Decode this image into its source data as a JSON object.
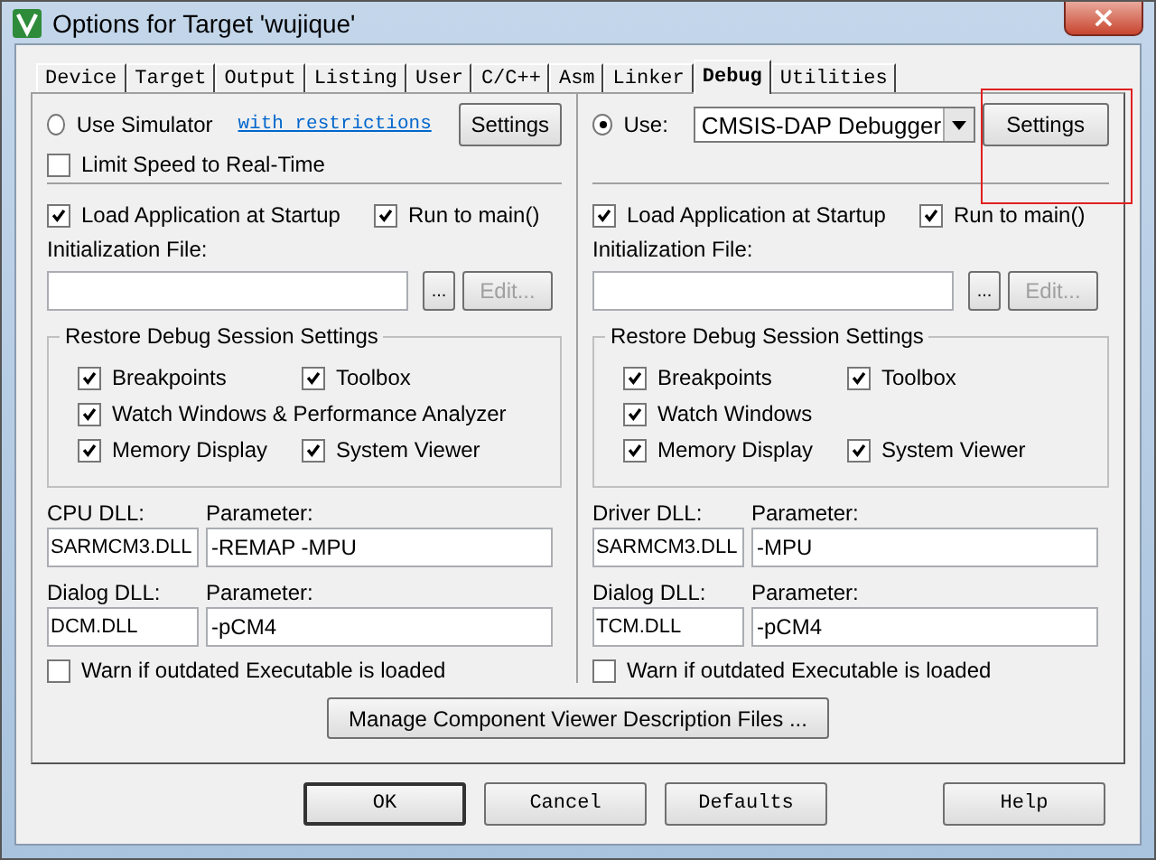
{
  "window": {
    "title": "Options for Target 'wujique'",
    "close": "×"
  },
  "tabs": [
    {
      "label": "Device",
      "selected": false
    },
    {
      "label": "Target",
      "selected": false
    },
    {
      "label": "Output",
      "selected": false
    },
    {
      "label": "Listing",
      "selected": false
    },
    {
      "label": "User",
      "selected": false
    },
    {
      "label": "C/C++",
      "selected": false
    },
    {
      "label": "Asm",
      "selected": false
    },
    {
      "label": "Linker",
      "selected": false
    },
    {
      "label": "Debug",
      "selected": true
    },
    {
      "label": "Utilities",
      "selected": false
    }
  ],
  "simulator": {
    "mode": {
      "label": "Use Simulator",
      "selected": false
    },
    "link": "with restrictions",
    "settings": "Settings",
    "limit_speed": {
      "label": "Limit Speed to Real-Time",
      "checked": false
    }
  },
  "target": {
    "mode": {
      "label": "Use:",
      "selected": true
    },
    "debugger": "CMSIS-DAP Debugger",
    "settings": "Settings"
  },
  "panels": [
    {
      "load_app": {
        "label": "Load Application at Startup",
        "checked": true
      },
      "run_to_main": {
        "label": "Run to main()",
        "checked": true
      },
      "init_label": "Initialization File:",
      "browse": "...",
      "edit": {
        "label": "Edit...",
        "disabled": true
      },
      "restore": {
        "title": "Restore Debug Session Settings",
        "rows": [
          [
            {
              "label": "Breakpoints",
              "checked": true
            },
            {
              "label": "Toolbox",
              "checked": true
            }
          ],
          [
            {
              "label": "Watch Windows & Performance Analyzer",
              "checked": true
            }
          ],
          [
            {
              "label": "Memory Display",
              "checked": true
            },
            {
              "label": "System Viewer",
              "checked": true
            }
          ]
        ]
      },
      "dlls": [
        {
          "label": "CPU DLL:",
          "value": "SARMCM3.DLL",
          "param_label": "Parameter:",
          "param": "-REMAP -MPU"
        },
        {
          "label": "Dialog DLL:",
          "value": "DCM.DLL",
          "param_label": "Parameter:",
          "param": "-pCM4"
        }
      ],
      "warn": {
        "label": "Warn if outdated Executable is loaded",
        "checked": false
      }
    },
    {
      "load_app": {
        "label": "Load Application at Startup",
        "checked": true
      },
      "run_to_main": {
        "label": "Run to main()",
        "checked": true
      },
      "init_label": "Initialization File:",
      "browse": "...",
      "edit": {
        "label": "Edit...",
        "disabled": true
      },
      "restore": {
        "title": "Restore Debug Session Settings",
        "rows": [
          [
            {
              "label": "Breakpoints",
              "checked": true
            },
            {
              "label": "Toolbox",
              "checked": true
            }
          ],
          [
            {
              "label": "Watch Windows",
              "checked": true
            }
          ],
          [
            {
              "label": "Memory Display",
              "checked": true
            },
            {
              "label": "System Viewer",
              "checked": true
            }
          ]
        ]
      },
      "dlls": [
        {
          "label": "Driver DLL:",
          "value": "SARMCM3.DLL",
          "param_label": "Parameter:",
          "param": "-MPU"
        },
        {
          "label": "Dialog DLL:",
          "value": "TCM.DLL",
          "param_label": "Parameter:",
          "param": "-pCM4"
        }
      ],
      "warn": {
        "label": "Warn if outdated Executable is loaded",
        "checked": false
      }
    }
  ],
  "manage": "Manage Component Viewer Description Files ...",
  "buttons": [
    {
      "label": "OK",
      "kind": "default"
    },
    {
      "label": "Cancel",
      "kind": "normal"
    },
    {
      "label": "Defaults",
      "kind": "normal"
    },
    {
      "label": "Help",
      "kind": "apart"
    }
  ]
}
